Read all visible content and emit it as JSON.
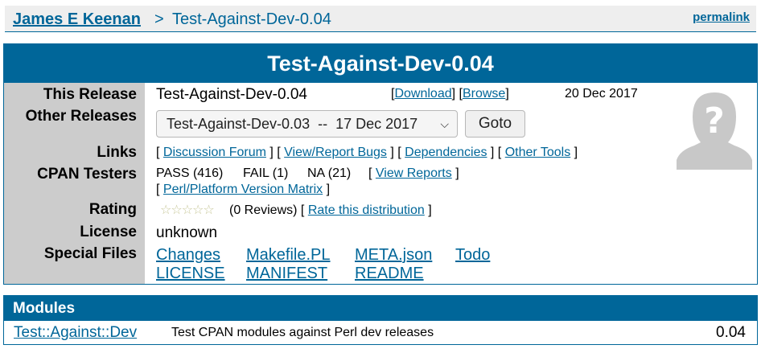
{
  "breadcrumb": {
    "author": "James E Keenan",
    "separator": ">",
    "distribution": "Test-Against-Dev-0.04",
    "permalink": "permalink"
  },
  "release": {
    "title": "Test-Against-Dev-0.04",
    "labels": {
      "this_release": "This Release",
      "other_releases": "Other Releases",
      "links": "Links",
      "cpan_testers": "CPAN Testers",
      "rating": "Rating",
      "license": "License",
      "special_files": "Special Files"
    },
    "this_release": {
      "name": "Test-Against-Dev-0.04",
      "download": "Download",
      "browse": "Browse",
      "date": "20 Dec 2017"
    },
    "other_releases": {
      "selected": "Test-Against-Dev-0.03  --  17 Dec 2017",
      "goto_label": "Goto"
    },
    "links": [
      "Discussion Forum",
      "View/Report Bugs",
      "Dependencies",
      "Other Tools"
    ],
    "cpan_testers": {
      "pass": "PASS (416)",
      "fail": "FAIL (1)",
      "na": "NA (21)",
      "view_reports": "View Reports",
      "matrix": "Perl/Platform Version Matrix"
    },
    "rating": {
      "stars": 0,
      "reviews": "(0 Reviews)",
      "rate_link": "Rate this distribution"
    },
    "license": "unknown",
    "special_files": [
      "Changes",
      "Makefile.PL",
      "META.json",
      "Todo",
      "LICENSE",
      "MANIFEST",
      "README"
    ]
  },
  "modules": {
    "heading": "Modules",
    "items": [
      {
        "name": "Test::Against::Dev",
        "description": "Test CPAN modules against Perl dev releases",
        "version": "0.04"
      }
    ]
  },
  "colors": {
    "brand": "#006699",
    "label_bg": "#cccccc",
    "crumb_bg": "#eeeeee"
  },
  "icons": {
    "avatar": "unknown-user-avatar-icon",
    "select_chevron": "chevron-down-icon",
    "rating": "star-icon"
  }
}
